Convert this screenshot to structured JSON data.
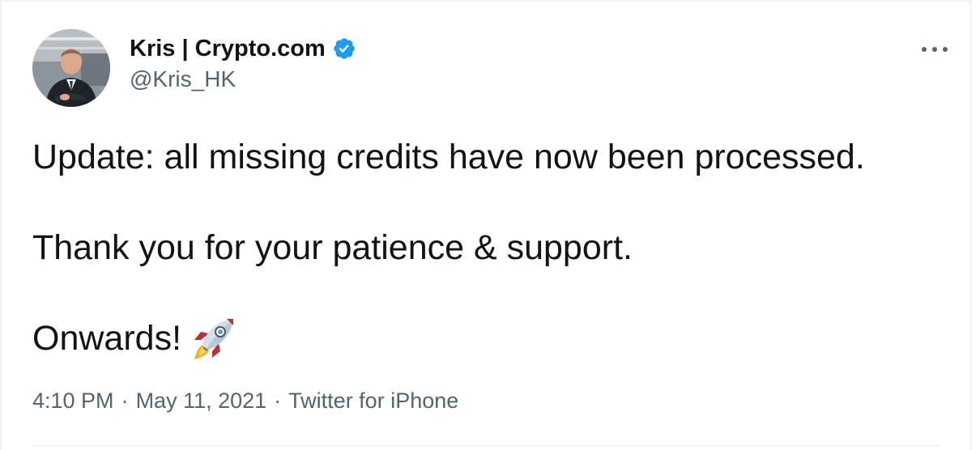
{
  "tweet": {
    "author": {
      "display_name": "Kris | Crypto.com",
      "handle": "@Kris_HK",
      "verified_icon": "verified-badge-icon",
      "avatar_icon": "profile-photo"
    },
    "more_icon": "more-options-icon",
    "paragraphs": [
      "Update: all missing credits have now been processed.",
      "Thank you for your patience & support.",
      "Onwards!"
    ],
    "emoji_icon": "rocket-emoji-icon",
    "meta": {
      "time": "4:10 PM",
      "separator": "·",
      "date": "May 11, 2021",
      "source": "Twitter for iPhone"
    },
    "colors": {
      "text": "#0f1419",
      "secondary": "#536471",
      "verified": "#1d9bf0",
      "border": "#eff3f4"
    }
  }
}
